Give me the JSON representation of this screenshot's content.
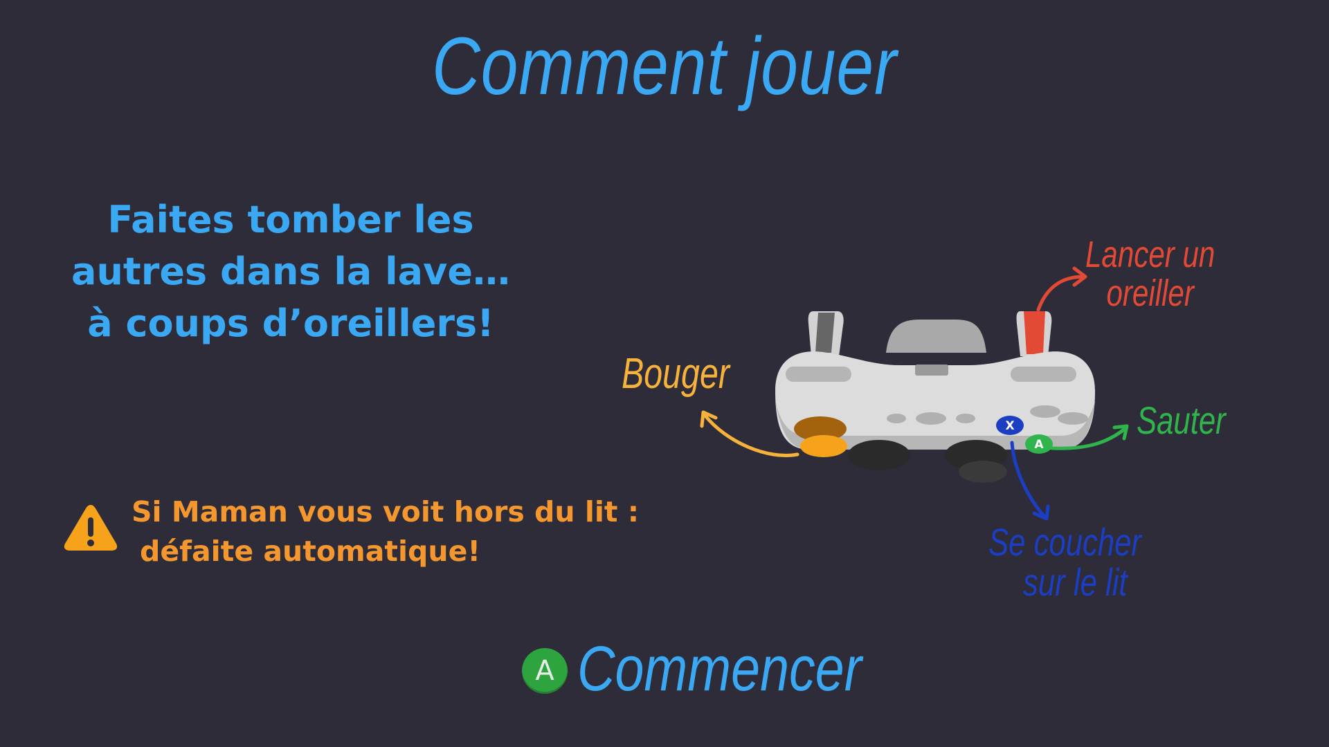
{
  "title": "Comment jouer",
  "intro": {
    "line1": "Faites tomber les",
    "line2": "autres dans la lave…",
    "line3": "à coups d’oreillers!"
  },
  "warning": {
    "icon": "warning-triangle-icon",
    "line1": "Si Maman vous voit hors du lit :",
    "line2": "défaite automatique!"
  },
  "controls": {
    "move": "Bouger",
    "throw_line1": "Lancer un",
    "throw_line2": "oreiller",
    "jump": "Sauter",
    "lie_line1": "Se coucher",
    "lie_line2": "sur le lit",
    "button_x": "X",
    "button_a": "A"
  },
  "start": {
    "button": "A",
    "label": "Commencer"
  },
  "colors": {
    "background": "#2e2c39",
    "title": "#3aa8f2",
    "warning": "#f4972f",
    "move": "#f6b23a",
    "throw": "#e34a35",
    "jump": "#2fb54b",
    "lie": "#1b3ec2"
  }
}
